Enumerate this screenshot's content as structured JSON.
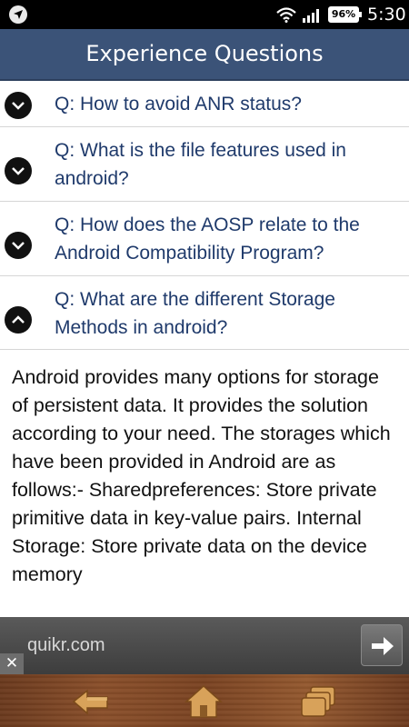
{
  "status_bar": {
    "battery": "96%",
    "time": "5:30"
  },
  "header": {
    "title": "Experience Questions"
  },
  "questions": [
    {
      "text": "Q: How to avoid ANR status?",
      "expanded": false
    },
    {
      "text": "Q: What is the file features used in android?",
      "expanded": false
    },
    {
      "text": "Q: How does the AOSP relate to the Android Compatibility Program?",
      "expanded": false
    },
    {
      "text": "Q: What are the different Storage Methods in android?",
      "expanded": true
    }
  ],
  "answer": {
    "text": "Android provides many options for storage of persistent data. It provides the solution according to your need. The storages which have been provided in Android are as follows:- Sharedpreferences: Store private primitive data in key-value pairs. Internal Storage: Store private data on the device memory"
  },
  "ad": {
    "text": "quikr.com",
    "close_label": "✕"
  },
  "bottom_nav": {
    "back_icon": "back-arrow-icon",
    "home_icon": "home-icon",
    "windows_icon": "windows-icon"
  }
}
